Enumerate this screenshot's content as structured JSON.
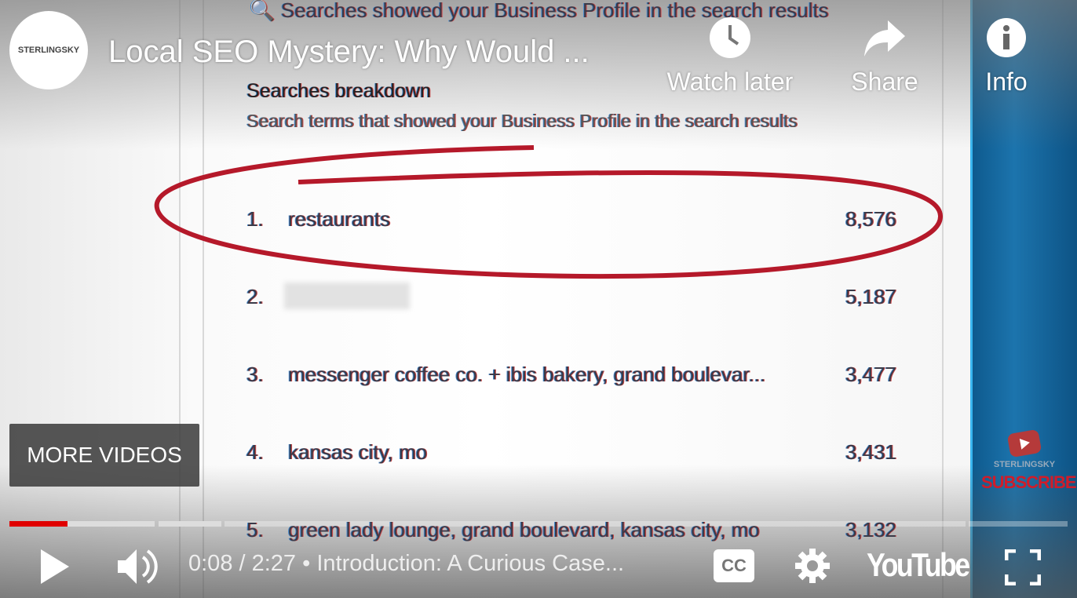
{
  "video_frame": {
    "search_header": "Searches showed your Business Profile in the search results",
    "section_title": "Searches breakdown",
    "section_subtitle": "Search terms that showed your Business Profile in the search results",
    "rows": [
      {
        "rank": "1.",
        "term": "restaurants",
        "count": "8,576"
      },
      {
        "rank": "2.",
        "term": "",
        "count": "5,187"
      },
      {
        "rank": "3.",
        "term": "messenger coffee co. + ibis bakery, grand boulevar...",
        "count": "3,477"
      },
      {
        "rank": "4.",
        "term": "kansas city, mo",
        "count": "3,431"
      },
      {
        "rank": "5.",
        "term": "green lady lounge, grand boulevard, kansas city, mo",
        "count": "3,132"
      }
    ],
    "side_brand": "STERLINGSKY",
    "side_subscribe": "SUBSCRIBE"
  },
  "header": {
    "channel_logo": "STERLINGSKY",
    "title": "Local SEO Mystery: Why Would ...",
    "watch_later": "Watch later",
    "share": "Share",
    "info": "Info"
  },
  "more_videos": "MORE VIDEOS",
  "controls": {
    "time": "0:08 / 2:27",
    "separator": "•",
    "chapter": "Introduction: A Curious Case...",
    "brand": "YouTube",
    "progress_fraction": 0.055
  },
  "colors": {
    "progress": "#e00000",
    "side_panel": "#1c74ad",
    "ellipse": "#b5192a"
  }
}
